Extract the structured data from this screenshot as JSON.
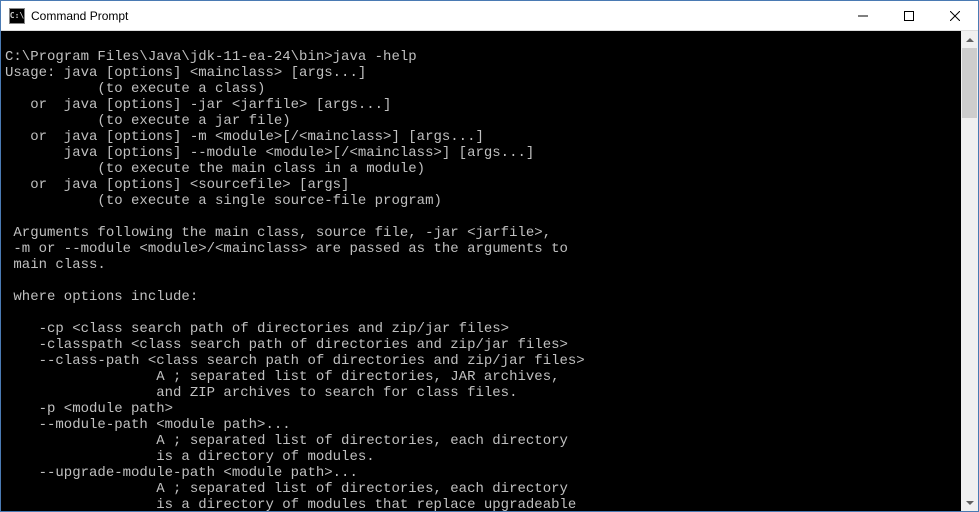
{
  "window": {
    "title": "Command Prompt",
    "icon_label": "C:\\"
  },
  "terminal": {
    "lines": [
      "",
      "C:\\Program Files\\Java\\jdk-11-ea-24\\bin>java -help",
      "Usage: java [options] <mainclass> [args...]",
      "           (to execute a class)",
      "   or  java [options] -jar <jarfile> [args...]",
      "           (to execute a jar file)",
      "   or  java [options] -m <module>[/<mainclass>] [args...]",
      "       java [options] --module <module>[/<mainclass>] [args...]",
      "           (to execute the main class in a module)",
      "   or  java [options] <sourcefile> [args]",
      "           (to execute a single source-file program)",
      "",
      " Arguments following the main class, source file, -jar <jarfile>,",
      " -m or --module <module>/<mainclass> are passed as the arguments to",
      " main class.",
      "",
      " where options include:",
      "",
      "    -cp <class search path of directories and zip/jar files>",
      "    -classpath <class search path of directories and zip/jar files>",
      "    --class-path <class search path of directories and zip/jar files>",
      "                  A ; separated list of directories, JAR archives,",
      "                  and ZIP archives to search for class files.",
      "    -p <module path>",
      "    --module-path <module path>...",
      "                  A ; separated list of directories, each directory",
      "                  is a directory of modules.",
      "    --upgrade-module-path <module path>...",
      "                  A ; separated list of directories, each directory",
      "                  is a directory of modules that replace upgradeable"
    ]
  }
}
